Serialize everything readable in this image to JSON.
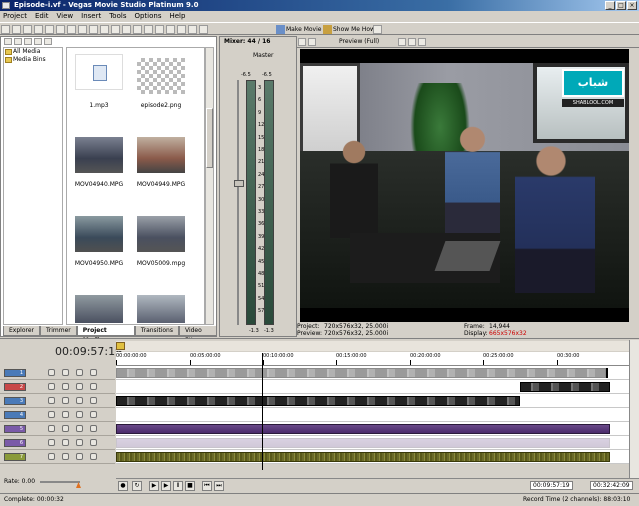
{
  "window": {
    "title": "Episode-i.vf - Vegas Movie Studio Platinum 9.0",
    "buttons": [
      "_",
      "□",
      "×"
    ]
  },
  "menu": [
    "Project",
    "Edit",
    "View",
    "Insert",
    "Tools",
    "Options",
    "Help"
  ],
  "toolbar": {
    "make_movie": "Make Movie",
    "show_me_how": "Show Me How"
  },
  "explorer": {
    "tree": [
      "All Media",
      "Media Bins"
    ],
    "media": [
      {
        "name": "1.mp3"
      },
      {
        "name": "episode2.png"
      },
      {
        "name": "MOV04940.MPG"
      },
      {
        "name": "MOV04949.MPG"
      },
      {
        "name": "MOV04950.MPG"
      },
      {
        "name": "MOV05009.mpg"
      }
    ],
    "tabs": [
      "Explorer",
      "Trimmer",
      "Project Media",
      "Transitions",
      "Video FX"
    ],
    "active_tab": "Project Media"
  },
  "mixer": {
    "title": "Mixer: 44 / 16",
    "master": "Master",
    "peak_left": "-6.5",
    "peak_right": "-6.5",
    "scale": [
      "3",
      "6",
      "9",
      "12",
      "15",
      "18",
      "21",
      "24",
      "27",
      "30",
      "33",
      "36",
      "39",
      "42",
      "45",
      "48",
      "51",
      "54",
      "57"
    ],
    "bottom_left": "-1.3",
    "bottom_right": "-1.3"
  },
  "preview": {
    "label": "Preview (Full)",
    "project_label": "Project:",
    "project_value": "720x576x32, 25.000i",
    "preview_label": "Preview:",
    "preview_value": "720x576x32, 25.000i",
    "frame_label": "Frame:",
    "frame_value": "14,944",
    "display_label": "Display:",
    "display_value": "665x576x32",
    "watermark_top": "شباب",
    "watermark_bottom": "SHABLOOL.COM"
  },
  "timeline": {
    "timecode": "00:09:57:19",
    "ruler": [
      "00:00:00:00",
      "00:05:00:00",
      "00:10:00:00",
      "00:15:00:00",
      "00:20:00:00",
      "00:25:00:00",
      "00:30:00"
    ],
    "tracks": [
      "1",
      "2",
      "3",
      "4",
      "5",
      "6",
      "7"
    ],
    "rate": "Rate: 0.00"
  },
  "transport": {
    "current": "00:09:57:19",
    "end": "00:32:42:09"
  },
  "status": {
    "complete": "Complete: 00:00:32",
    "record_time": "Record Time (2 channels): 88:03:10"
  },
  "colors": {
    "title_from": "#0a246a",
    "title_to": "#a6caf0",
    "track_video": "#4a7ab8",
    "track_audio1": "#7a5aa8",
    "track_audio2": "#8a9a3a"
  }
}
